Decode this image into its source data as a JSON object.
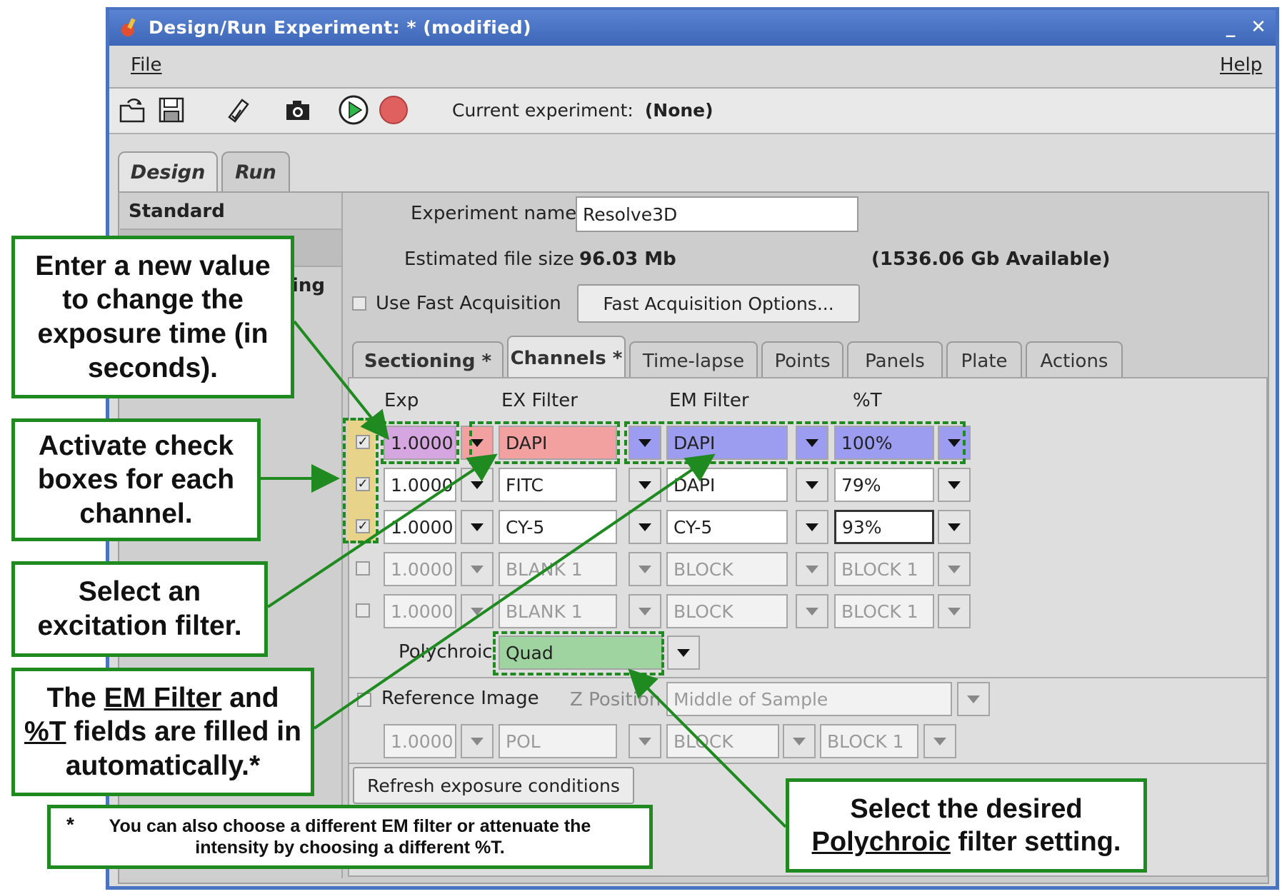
{
  "window": {
    "title": "Design/Run Experiment:  * (modified)",
    "min_glyph": "_",
    "close_glyph": "✕",
    "title_bar_color": "#4a74c2"
  },
  "menubar": {
    "file": "File",
    "help": "Help"
  },
  "toolbar": {
    "icons": [
      "open-icon",
      "save-icon",
      "checklist-icon",
      "camera-icon",
      "play-icon",
      "stop-icon"
    ],
    "current_experiment_label": "Current experiment:",
    "current_experiment_value": "(None)"
  },
  "tabs": {
    "design": "Design",
    "run": "Run"
  },
  "sidebar": {
    "standard": "Standard",
    "partial_item": "ling"
  },
  "form": {
    "experiment_name_label": "Experiment name",
    "experiment_name_value": "Resolve3D",
    "file_size_label": "Estimated file size",
    "file_size_value": "96.03 Mb",
    "available": "(1536.06 Gb Available)",
    "fast_acq_label": "Use Fast Acquisition",
    "fast_acq_button": "Fast Acquisition Options..."
  },
  "subtabs": [
    {
      "label": "Sectioning *"
    },
    {
      "label": "Channels *"
    },
    {
      "label": "Time-lapse"
    },
    {
      "label": "Points"
    },
    {
      "label": "Panels"
    },
    {
      "label": "Plate"
    },
    {
      "label": "Actions"
    }
  ],
  "columns": {
    "exp": "Exp",
    "ex": "EX Filter",
    "em": "EM Filter",
    "t": "%T"
  },
  "channels": [
    {
      "checked": "✓",
      "exp": "1.0000",
      "ex": "DAPI",
      "em": "DAPI",
      "t": "100%"
    },
    {
      "checked": "✓",
      "exp": "1.0000",
      "ex": "FITC",
      "em": "DAPI",
      "t": "79%"
    },
    {
      "checked": "✓",
      "exp": "1.0000",
      "ex": "CY-5",
      "em": "CY-5",
      "t": "93%"
    },
    {
      "checked": "",
      "exp": "1.0000",
      "ex": "BLANK 1",
      "em": "BLOCK",
      "t": "BLOCK 1"
    },
    {
      "checked": "",
      "exp": "1.0000",
      "ex": "BLANK 1",
      "em": "BLOCK",
      "t": "BLOCK 1"
    }
  ],
  "polychroic": {
    "label": "Polychroic",
    "value": "Quad"
  },
  "reference": {
    "label": "Reference Image",
    "z_label": "Z Position",
    "z_value": "Middle of Sample",
    "exp": "1.0000",
    "ex": "POL",
    "em": "BLOCK",
    "t": "BLOCK 1"
  },
  "refresh_button": "Refresh exposure conditions",
  "callouts": {
    "exposure": "Enter a new value to change the exposure time (in seconds).",
    "checkbox": "Activate check boxes for each channel.",
    "excitation": "Select an excitation filter.",
    "em_auto_pre": "The",
    "em_auto_em": "EM Filter",
    "em_auto_and": "and",
    "em_auto_t": "%T",
    "em_auto_post": "fields are filled in automatically.*",
    "footnote_star": "*",
    "footnote": "You can also choose a different EM filter or attenuate the intensity by choosing a different %T.",
    "poly_pre": "Select the desired",
    "poly_u": "Polychroic",
    "poly_post": "filter setting."
  },
  "colors": {
    "callout_green": "#1f8a1f",
    "exp_highlight": "#d6a6e0",
    "ex_highlight": "#f2a0a0",
    "em_highlight": "#9c9cf0",
    "check_highlight": "#e7d38a",
    "poly_highlight": "#9fd39f"
  }
}
